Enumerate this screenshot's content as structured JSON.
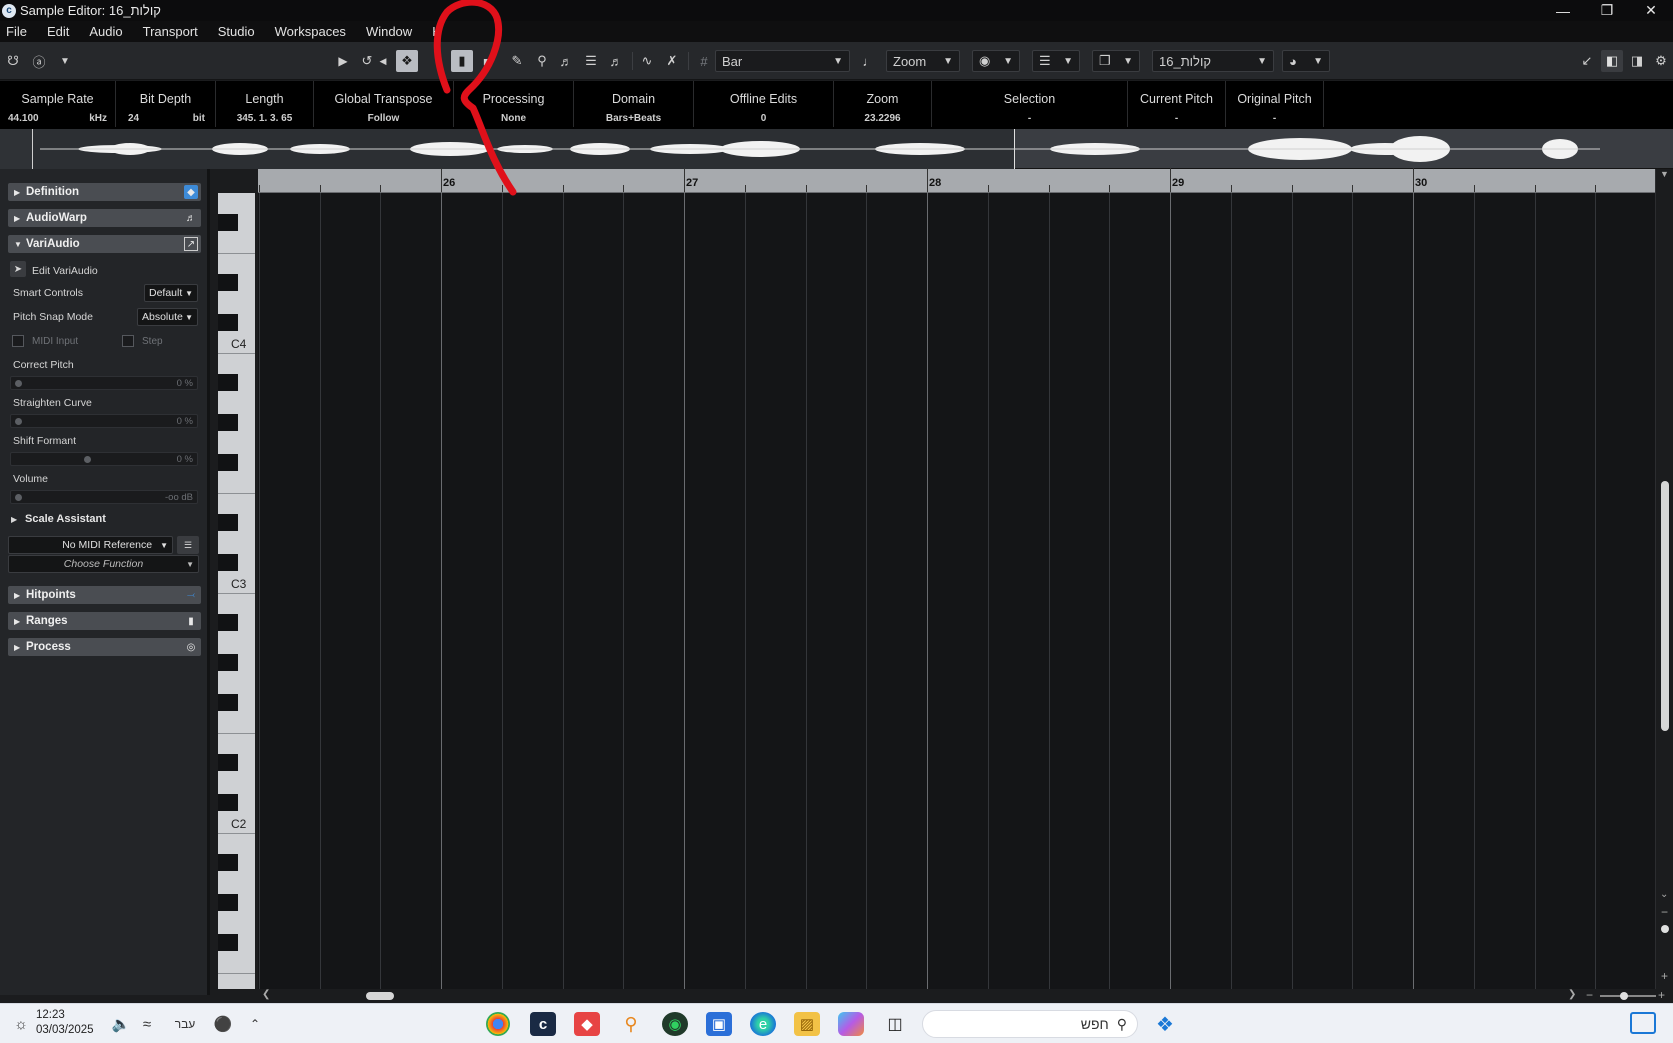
{
  "window": {
    "title": "Sample Editor: 16_קולות"
  },
  "menu": [
    "File",
    "Edit",
    "Audio",
    "Transport",
    "Studio",
    "Workspaces",
    "Window",
    "H"
  ],
  "toolbar": {
    "grid_label": "Bar",
    "zoom_label": "Zoom",
    "clip_name": "16_קולות"
  },
  "info": {
    "sample_rate": {
      "label": "Sample Rate",
      "value": "44.100",
      "unit": "kHz"
    },
    "bit_depth": {
      "label": "Bit Depth",
      "value": "24",
      "unit": "bit"
    },
    "length": {
      "label": "Length",
      "value": "345. 1. 3. 65"
    },
    "global_transpose": {
      "label": "Global Transpose",
      "value": "Follow"
    },
    "processing": {
      "label": "Processing",
      "value": "None"
    },
    "domain": {
      "label": "Domain",
      "value": "Bars+Beats"
    },
    "offline_edits": {
      "label": "Offline Edits",
      "value": "0"
    },
    "zoom": {
      "label": "Zoom",
      "value": "23.2296"
    },
    "selection": {
      "label": "Selection",
      "value": "-"
    },
    "current_pitch": {
      "label": "Current Pitch",
      "value": "-"
    },
    "original_pitch": {
      "label": "Original Pitch",
      "value": "-"
    }
  },
  "inspector": {
    "definition": "Definition",
    "audiowarp": "AudioWarp",
    "variaudio": "VariAudio",
    "edit_variaudio": "Edit VariAudio",
    "smart_controls": {
      "label": "Smart Controls",
      "value": "Default"
    },
    "pitch_snap_mode": {
      "label": "Pitch Snap Mode",
      "value": "Absolute"
    },
    "midi_input": "MIDI Input",
    "step": "Step",
    "correct_pitch": {
      "label": "Correct Pitch",
      "value": "0 %",
      "level": 0
    },
    "straighten_curve": {
      "label": "Straighten Curve",
      "value": "0 %",
      "level": 0
    },
    "shift_formant": {
      "label": "Shift Formant",
      "value": "0 %",
      "level": 0.5
    },
    "volume": {
      "label": "Volume",
      "value": "-oo dB",
      "level": 0
    },
    "scale_assistant": "Scale Assistant",
    "midi_reference": "No MIDI Reference",
    "choose_function": "Choose Function",
    "hitpoints": "Hitpoints",
    "ranges": "Ranges",
    "process": "Process"
  },
  "ruler": {
    "bars": [
      "26",
      "27",
      "28",
      "29",
      "30"
    ]
  },
  "keyboard": {
    "notes": [
      "C4",
      "C3",
      "C2"
    ]
  },
  "taskbar": {
    "time": "12:23",
    "date": "03/03/2025",
    "lang": "עבר",
    "search_placeholder": "חפש"
  },
  "colors": {
    "annotation": "#e0101a",
    "accent": "#3d8bd8"
  }
}
